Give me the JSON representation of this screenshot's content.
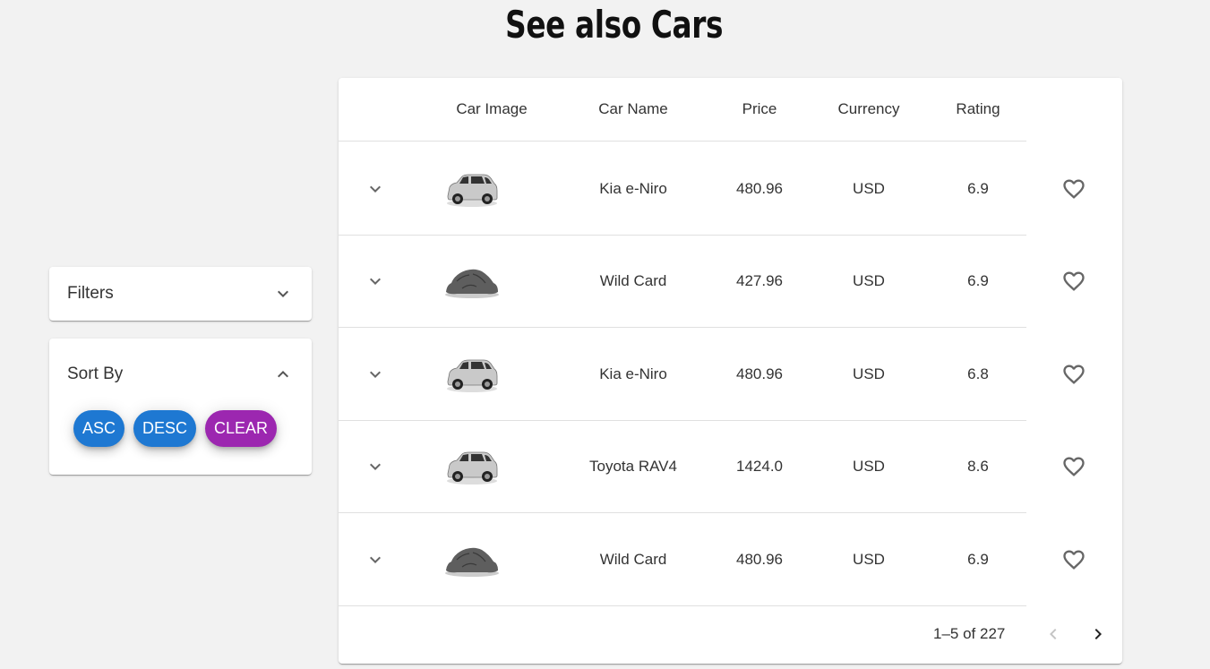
{
  "page": {
    "title": "See also Cars"
  },
  "filters": {
    "label": "Filters",
    "icon": "chevron-down-icon"
  },
  "sort": {
    "label": "Sort By",
    "icon": "chevron-up-icon",
    "buttons": [
      {
        "label": "ASC",
        "color": "#1e78d2"
      },
      {
        "label": "DESC",
        "color": "#1e78d2"
      },
      {
        "label": "CLEAR",
        "color": "#9c27b0"
      }
    ]
  },
  "table": {
    "headers": {
      "image": "Car Image",
      "name": "Car Name",
      "price": "Price",
      "currency": "Currency",
      "rating": "Rating"
    },
    "rows": [
      {
        "image": "suv-car-image",
        "name": "Kia e-Niro",
        "price": "480.96",
        "currency": "USD",
        "rating": "6.9"
      },
      {
        "image": "covered-car-image",
        "name": "Wild Card",
        "price": "427.96",
        "currency": "USD",
        "rating": "6.9"
      },
      {
        "image": "suv-car-image",
        "name": "Kia e-Niro",
        "price": "480.96",
        "currency": "USD",
        "rating": "6.8"
      },
      {
        "image": "suv-car-image",
        "name": "Toyota RAV4",
        "price": "1424.0",
        "currency": "USD",
        "rating": "8.6"
      },
      {
        "image": "covered-car-image",
        "name": "Wild Card",
        "price": "480.96",
        "currency": "USD",
        "rating": "6.9"
      }
    ]
  },
  "pagination": {
    "range_text": "1–5 of 227",
    "prev_enabled": false,
    "next_enabled": true
  },
  "colors": {
    "background": "#f2f2f2",
    "primary": "#1e78d2",
    "secondary": "#9c27b0"
  }
}
